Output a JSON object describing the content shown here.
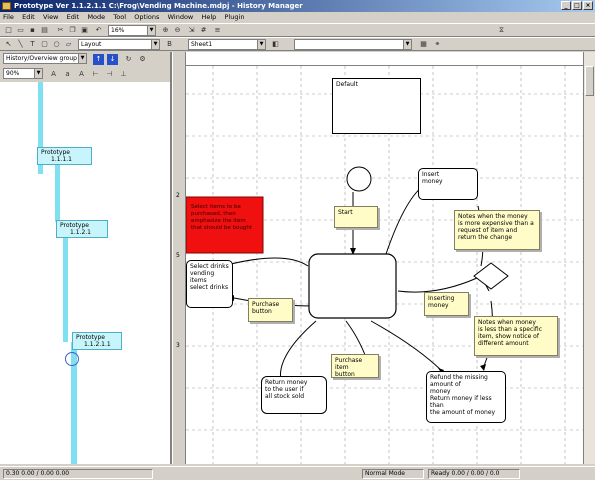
{
  "window": {
    "title": "Prototype Ver 1.1.2.1.1 C:\\Frog\\Vending Machine.mdpj - History Manager",
    "minimize": "_",
    "maximize": "□",
    "close": "×"
  },
  "menu": [
    "File",
    "Edit",
    "View",
    "Edit",
    "Mode",
    "Tool",
    "Options",
    "Window",
    "Help",
    "Plugin"
  ],
  "toolbar1": {
    "zoom_value": "16%",
    "buttons": [
      "new-icon",
      "open-icon",
      "save-icon",
      "print-icon"
    ]
  },
  "toolbar2": {
    "layout_combo": "Layout",
    "sheet_combo": "Sheet1",
    "blank_combo": ""
  },
  "left_panel": {
    "view_combo": "History/Overview group",
    "zoom_combo": "90%",
    "nodes": [
      {
        "title": "Prototype",
        "ver": "1.1.1.1"
      },
      {
        "title": "Prototype",
        "ver": "1.1.2.1"
      },
      {
        "title": "Prototype",
        "ver": "1.1.2.1.1"
      }
    ]
  },
  "ruler": {
    "v_marks": [
      "2",
      "5",
      "3"
    ]
  },
  "canvas": {
    "topbox": "Default",
    "redbox": "Select items to be\npurchased, then\nemphasize the item\nthat should be bought",
    "leftbox": "Select drinks\nvending items\nselect drinks",
    "right_top_box": "Insert\nmoney",
    "bottom_left_box": "Return money\nto the user if\nall stock sold",
    "bottom_right_box": "Refund the missing amount of\nmoney\nReturn money if less than\nthe amount of money",
    "notes": {
      "start": "Start",
      "select": "Purchase\nbutton",
      "inserting": "Inserting\nmoney",
      "purchase": "Purchase item\nbutton",
      "right_note": "Notes when the money\nis more expensive than a\nrequest of item and\nreturn the change",
      "right_note2": "Notes when money\nis less than a specific\nitem, show notice of\ndifferent amount"
    }
  },
  "status": {
    "left": "0.30 0.00 / 0.00 0.00",
    "mid": "Normal Mode",
    "right": "Ready 0.00 / 0.00 / 0.0"
  }
}
